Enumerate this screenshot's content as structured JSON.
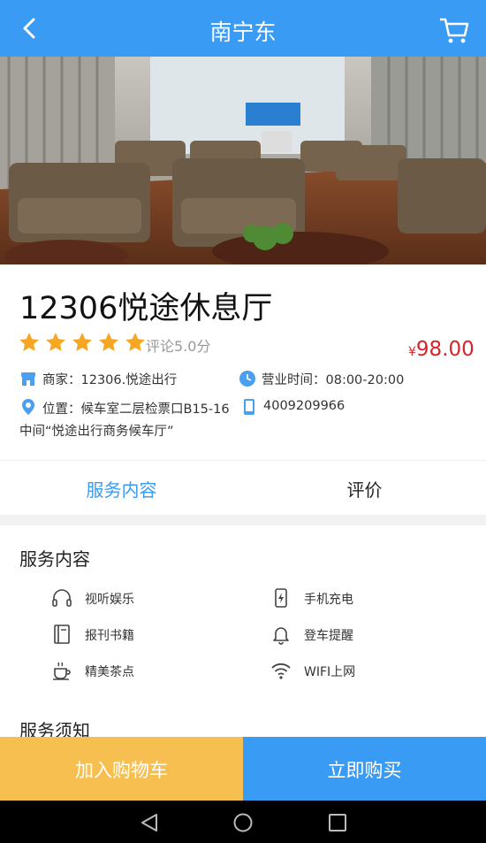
{
  "header": {
    "title": "南宁东"
  },
  "product": {
    "name": "12306悦途休息厅",
    "rating_text": "评论5.0分",
    "stars": 5,
    "price_currency": "¥",
    "price_value": "98.00",
    "merchant": "商家：12306.悦途出行",
    "hours": "营业时间：08:00-20:00",
    "location": "位置：候车室二层检票口B15-16",
    "location_cont": "中间“悦途出行商务候车厅”",
    "phone": "4009209966"
  },
  "tabs": [
    {
      "label": "服务内容"
    },
    {
      "label": "评价"
    }
  ],
  "services": {
    "title": "服务内容",
    "items": [
      {
        "label": "视听娱乐",
        "icon": "headphones-icon"
      },
      {
        "label": "手机充电",
        "icon": "phone-charge-icon"
      },
      {
        "label": "报刊书籍",
        "icon": "book-icon"
      },
      {
        "label": "登车提醒",
        "icon": "bell-icon"
      },
      {
        "label": "精美茶点",
        "icon": "tea-icon"
      },
      {
        "label": "WIFI上网",
        "icon": "wifi-icon"
      }
    ]
  },
  "notice": {
    "title": "服务须知"
  },
  "actions": {
    "add_to_cart": "加入购物车",
    "buy_now": "立即购买"
  },
  "colors": {
    "accent": "#3a9bf5",
    "cart_button": "#f6bf4f",
    "price": "#d6242a",
    "star": "#f5a623"
  }
}
